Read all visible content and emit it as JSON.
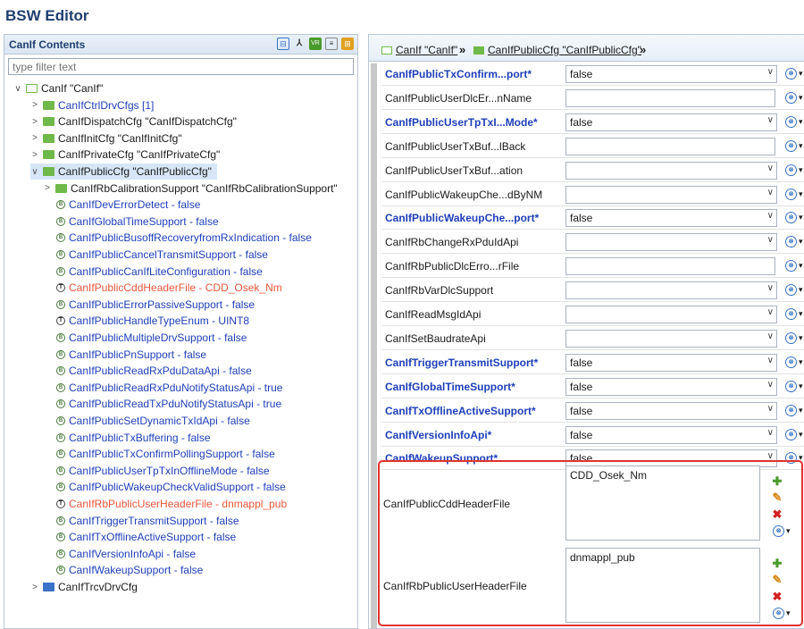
{
  "app": {
    "title": "BSW Editor"
  },
  "left_panel": {
    "title": "CanIf Contents",
    "filter_placeholder": "type filter text",
    "tree": [
      {
        "label": "CanIf \"CanIf\"",
        "arrow": "∨",
        "icon": "folder-outline",
        "color": "dark",
        "level": 0
      },
      {
        "label": "CanIfCtrlDrvCfgs [1]",
        "arrow": ">",
        "icon": "folder",
        "color": "blue",
        "level": 1
      },
      {
        "label": "CanIfDispatchCfg \"CanIfDispatchCfg\"",
        "arrow": ">",
        "icon": "folder",
        "color": "dark",
        "level": 1
      },
      {
        "label": "CanIfInitCfg \"CanIfInitCfg\"",
        "arrow": ">",
        "icon": "folder",
        "color": "dark",
        "level": 1
      },
      {
        "label": "CanIfPrivateCfg \"CanIfPrivateCfg\"",
        "arrow": ">",
        "icon": "folder",
        "color": "dark",
        "level": 1
      },
      {
        "label": "CanIfPublicCfg \"CanIfPublicCfg\"",
        "arrow": "∨",
        "icon": "folder",
        "color": "dark",
        "level": 1,
        "selected": true
      },
      {
        "label": "CanIfRbCalibrationSupport \"CanIfRbCalibrationSupport\"",
        "arrow": ">",
        "icon": "folder",
        "color": "dark",
        "level": 2
      },
      {
        "label": "CanIfDevErrorDetect - false",
        "icon": "param-icon",
        "color": "blue",
        "level": 3
      },
      {
        "label": "CanIfGlobalTimeSupport - false",
        "icon": "param-icon",
        "color": "blue",
        "level": 3
      },
      {
        "label": "CanIfPublicBusoffRecoveryfromRxIndication - false",
        "icon": "param-icon",
        "color": "blue",
        "level": 3
      },
      {
        "label": "CanIfPublicCancelTransmitSupport - false",
        "icon": "param-icon",
        "color": "blue",
        "level": 3
      },
      {
        "label": "CanIfPublicCanIfLiteConfiguration - false",
        "icon": "param-icon",
        "color": "blue",
        "level": 3
      },
      {
        "label": "CanIfPublicCddHeaderFile - CDD_Osek_Nm",
        "icon": "text-icon",
        "color": "red",
        "level": 3
      },
      {
        "label": "CanIfPublicErrorPassiveSupport - false",
        "icon": "param-icon",
        "color": "blue",
        "level": 3
      },
      {
        "label": "CanIfPublicHandleTypeEnum - UINT8",
        "icon": "text-icon",
        "color": "blue",
        "level": 3
      },
      {
        "label": "CanIfPublicMultipleDrvSupport - false",
        "icon": "param-icon",
        "color": "blue",
        "level": 3
      },
      {
        "label": "CanIfPublicPnSupport - false",
        "icon": "param-icon",
        "color": "blue",
        "level": 3
      },
      {
        "label": "CanIfPublicReadRxPduDataApi - false",
        "icon": "param-icon",
        "color": "blue",
        "level": 3
      },
      {
        "label": "CanIfPublicReadRxPduNotifyStatusApi - true",
        "icon": "param-icon",
        "color": "blue",
        "level": 3
      },
      {
        "label": "CanIfPublicReadTxPduNotifyStatusApi - true",
        "icon": "param-icon",
        "color": "blue",
        "level": 3
      },
      {
        "label": "CanIfPublicSetDynamicTxIdApi - false",
        "icon": "param-icon",
        "color": "blue",
        "level": 3
      },
      {
        "label": "CanIfPublicTxBuffering - false",
        "icon": "param-icon",
        "color": "blue",
        "level": 3
      },
      {
        "label": "CanIfPublicTxConfirmPollingSupport - false",
        "icon": "param-icon",
        "color": "blue",
        "level": 3
      },
      {
        "label": "CanIfPublicUserTpTxInOfflineMode - false",
        "icon": "param-icon",
        "color": "blue",
        "level": 3
      },
      {
        "label": "CanIfPublicWakeupCheckValidSupport - false",
        "icon": "param-icon",
        "color": "blue",
        "level": 3
      },
      {
        "label": "CanIfRbPublicUserHeaderFile - dnmappl_pub",
        "icon": "text-icon",
        "color": "red",
        "level": 3
      },
      {
        "label": "CanIfTriggerTransmitSupport - false",
        "icon": "param-icon",
        "color": "blue",
        "level": 3
      },
      {
        "label": "CanIfTxOfflineActiveSupport - false",
        "icon": "param-icon",
        "color": "blue",
        "level": 3
      },
      {
        "label": "CanIfVersionInfoApi - false",
        "icon": "param-icon",
        "color": "blue",
        "level": 3
      },
      {
        "label": "CanIfWakeupSupport - false",
        "icon": "param-icon",
        "color": "blue",
        "level": 3
      },
      {
        "label": "CanIfTrcvDrvCfg",
        "arrow": ">",
        "icon": "folder-blue",
        "color": "dark",
        "level": 1
      }
    ]
  },
  "breadcrumb": {
    "item1": "CanIf \"CanIf\"",
    "item2": "CanIfPublicCfg \"CanIfPublicCfg\"",
    "sep": "»"
  },
  "params": [
    {
      "label": "CanIfPublicTxConfirm...port*",
      "bold": true,
      "value": "false",
      "dropdown": true
    },
    {
      "label": "CanIfPublicUserDlcEr...nName",
      "bold": false,
      "value": "",
      "dropdown": false
    },
    {
      "label": "CanIfPublicUserTpTxI...Mode*",
      "bold": true,
      "value": "false",
      "dropdown": true
    },
    {
      "label": "CanIfPublicUserTxBuf...lBack",
      "bold": false,
      "value": "",
      "dropdown": false
    },
    {
      "label": "CanIfPublicUserTxBuf...ation",
      "bold": false,
      "value": "",
      "dropdown": true
    },
    {
      "label": "CanIfPublicWakeupChe...dByNM",
      "bold": false,
      "value": "",
      "dropdown": true
    },
    {
      "label": "CanIfPublicWakeupChe...port*",
      "bold": true,
      "value": "false",
      "dropdown": true
    },
    {
      "label": "CanIfRbChangeRxPduIdApi",
      "bold": false,
      "value": "",
      "dropdown": true
    },
    {
      "label": "CanIfRbPublicDlcErro...rFile",
      "bold": false,
      "value": "",
      "dropdown": false
    },
    {
      "label": "CanIfRbVarDlcSupport",
      "bold": false,
      "value": "",
      "dropdown": true
    },
    {
      "label": "CanIfReadMsgIdApi",
      "bold": false,
      "value": "",
      "dropdown": true
    },
    {
      "label": "CanIfSetBaudrateApi",
      "bold": false,
      "value": "",
      "dropdown": true
    },
    {
      "label": "CanIfTriggerTransmitSupport*",
      "bold": true,
      "value": "false",
      "dropdown": true
    },
    {
      "label": "CanIfGlobalTimeSupport*",
      "bold": true,
      "value": "false",
      "dropdown": true
    },
    {
      "label": "CanIfTxOfflineActiveSupport*",
      "bold": true,
      "value": "false",
      "dropdown": true
    },
    {
      "label": "CanIfVersionInfoApi*",
      "bold": true,
      "value": "false",
      "dropdown": true
    },
    {
      "label": "CanIfWakeupSupport*",
      "bold": true,
      "value": "false",
      "dropdown": true
    }
  ],
  "multi_params": [
    {
      "label": "CanIfPublicCddHeaderFile",
      "value": "CDD_Osek_Nm"
    },
    {
      "label": "CanIfRbPublicUserHeaderFile",
      "value": "dnmappl_pub"
    }
  ],
  "colors": {
    "highlight": "#e0322f",
    "accent": "#1f3fb8",
    "warning_text": "#e8573a"
  }
}
